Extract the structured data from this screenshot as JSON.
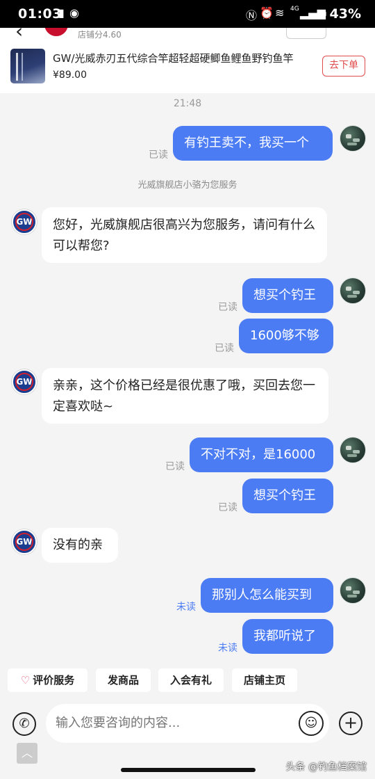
{
  "status_bar": {
    "time": "01:03",
    "network": "4G",
    "battery": "43%"
  },
  "store": {
    "score": "店铺分4.60"
  },
  "product": {
    "title": "GW/光威赤刃五代综合竿超轻超硬鲫鱼鲤鱼野钓鱼竿",
    "price": "¥89.00",
    "order_button": "去下单"
  },
  "chat": {
    "time": "21:48",
    "system_note": "光威旗舰店小骆为您服务",
    "store_avatar_text": "GW",
    "messages": [
      {
        "from": "user",
        "text": "有钓王卖不，我买一个",
        "status": "已读"
      },
      {
        "from": "store",
        "text": "您好，光威旗舰店很高兴为您服务，请问有什么可以帮您?"
      },
      {
        "from": "user",
        "text": "想买个钓王",
        "status": "已读"
      },
      {
        "from": "user",
        "text": "1600够不够",
        "status": "已读"
      },
      {
        "from": "store",
        "text": "亲亲，这个价格已经是很优惠了哦，买回去您一定喜欢哒~"
      },
      {
        "from": "user",
        "text": "不对不对，是16000",
        "status": "已读"
      },
      {
        "from": "user",
        "text": "想买个钓王",
        "status": "已读"
      },
      {
        "from": "store",
        "text": "没有的亲"
      },
      {
        "from": "user",
        "text": "那别人怎么能买到",
        "status": "未读"
      },
      {
        "from": "user",
        "text": "我都听说了",
        "status": "未读"
      }
    ]
  },
  "quick_actions": [
    "评价服务",
    "发商品",
    "入会有礼",
    "店铺主页"
  ],
  "input": {
    "placeholder": "输入您要咨询的内容..."
  },
  "watermark": "头条 @钓鱼档案馆",
  "colors": {
    "outgoing_bubble": "#4c7cf3",
    "unread": "#4c7cf3",
    "order_button": "#e04b4b"
  }
}
